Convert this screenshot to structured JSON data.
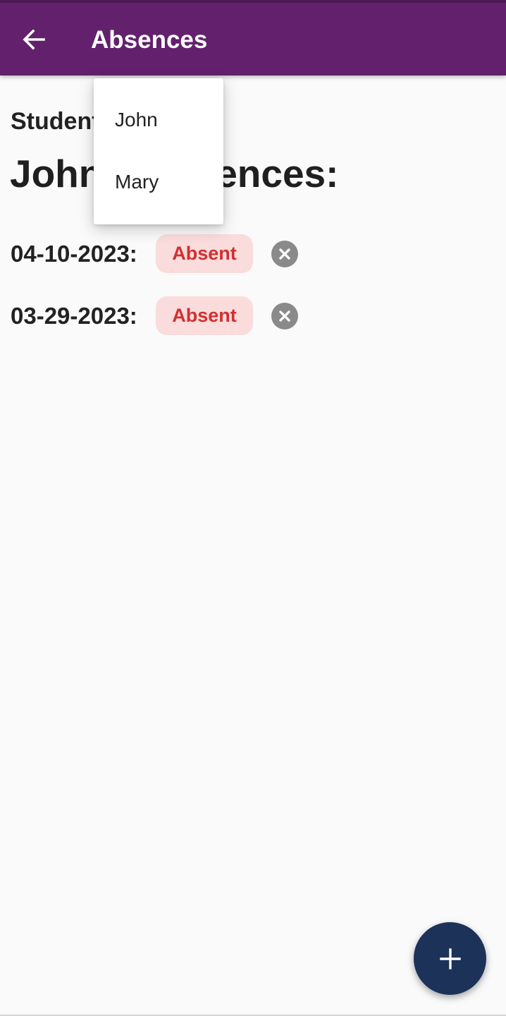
{
  "app_bar": {
    "title": "Absences",
    "back_icon": "arrow-back-icon"
  },
  "content": {
    "student_label": "Student",
    "heading": "John's Absences:"
  },
  "absences": [
    {
      "date": "04-10-2023:",
      "status": "Absent",
      "remove_icon": "cancel-circle-icon"
    },
    {
      "date": "03-29-2023:",
      "status": "Absent",
      "remove_icon": "cancel-circle-icon"
    }
  ],
  "dropdown": {
    "options": [
      "John",
      "Mary"
    ]
  },
  "fab": {
    "icon": "plus-icon"
  },
  "colors": {
    "app_bar": "#63206d",
    "status_strip": "#4e1a55",
    "background": "#fafafa",
    "chip_background": "#fadcdc",
    "chip_text": "#d32f2f",
    "remove_icon": "#8a8a8a",
    "fab": "#1c3259"
  }
}
